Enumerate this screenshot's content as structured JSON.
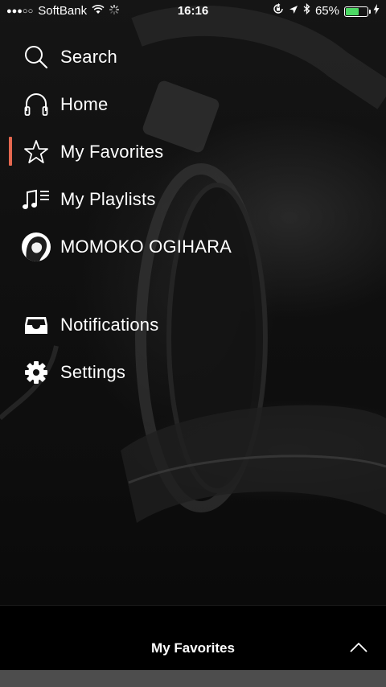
{
  "status_bar": {
    "signal": "●●●○○",
    "carrier": "SoftBank",
    "time": "16:16",
    "battery_percent": "65%",
    "battery_level": 0.65,
    "battery_color": "#4cd964",
    "icons": [
      "wifi-icon",
      "loading-icon",
      "orientation-lock-icon",
      "location-icon",
      "bluetooth-icon",
      "charging-icon"
    ]
  },
  "menu": {
    "accent_color": "#e5684f",
    "items": [
      {
        "label": "Search",
        "icon": "search-icon"
      },
      {
        "label": "Home",
        "icon": "headphones-icon"
      },
      {
        "label": "My Favorites",
        "icon": "star-icon",
        "active": true
      },
      {
        "label": "My Playlists",
        "icon": "playlist-icon"
      },
      {
        "label": "MOMOKO OGIHARA",
        "icon": "avatar"
      },
      {
        "label": "Notifications",
        "icon": "inbox-icon"
      },
      {
        "label": "Settings",
        "icon": "gear-icon"
      }
    ]
  },
  "bottom_bar": {
    "title": "My Favorites",
    "icon": "chevron-up-icon"
  }
}
